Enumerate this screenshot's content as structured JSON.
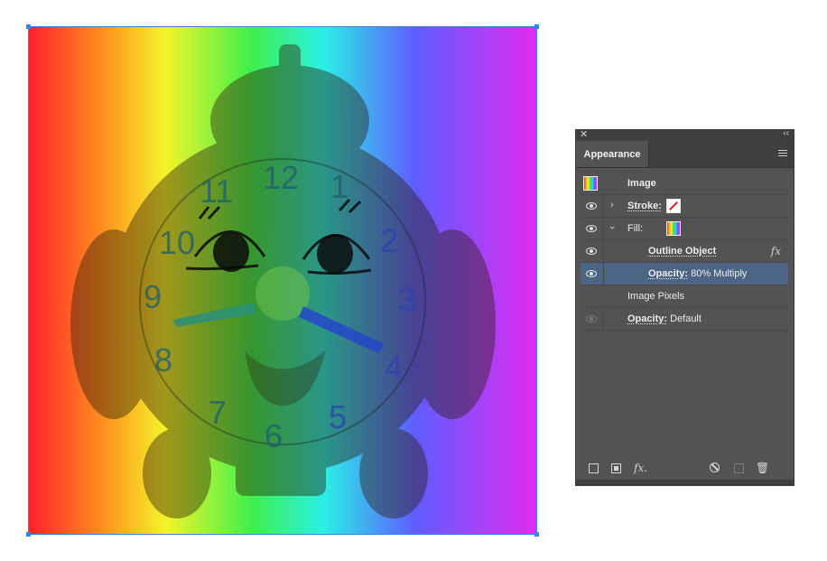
{
  "canvas": {
    "image_description_icon": "clock-toy-photo",
    "gradient_colors": [
      "#ff1f2e",
      "#ff8a1e",
      "#f4f42a",
      "#3ef04c",
      "#2af0e6",
      "#5f5cff",
      "#e12cf0"
    ]
  },
  "panel": {
    "tab_label": "Appearance",
    "rows": {
      "image": {
        "label": "Image"
      },
      "stroke": {
        "label": "Stroke:"
      },
      "fill": {
        "label": "Fill:"
      },
      "outline": {
        "label": "Outline Object",
        "fx": "fx"
      },
      "opacity_sel": {
        "label": "Opacity:",
        "value": "80% Multiply"
      },
      "pixels": {
        "label": "Image Pixels"
      },
      "opacity": {
        "label": "Opacity:",
        "value": "Default"
      }
    },
    "bottom_fx": "fx."
  },
  "colors": {
    "panel_bg": "#535353",
    "selection": "#4c6585"
  }
}
